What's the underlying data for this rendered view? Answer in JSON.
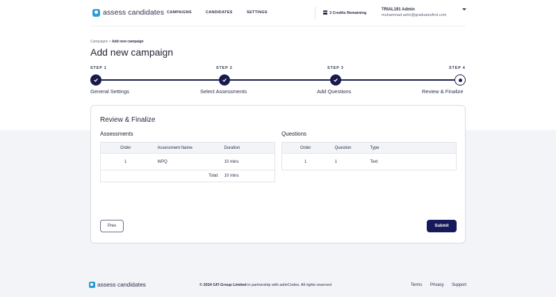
{
  "brand": {
    "logo_text": "assess candidates",
    "accent": "#171a4e",
    "logo_color": "#2a9bd6"
  },
  "header": {
    "nav": [
      "CAMPAIGNS",
      "CANDIDATES",
      "SETTINGS"
    ],
    "credits": "3 Credits Remaining",
    "user_name": "TRIAL191 Admin",
    "user_email": "muhammad.ashir@graduatesfirst.com"
  },
  "breadcrumb": {
    "parent": "Campaigns",
    "separator": ">",
    "current": "Add new campaign"
  },
  "page_title": "Add new campaign",
  "steps": [
    {
      "label": "STEP 1",
      "name": "General Settings",
      "status": "complete"
    },
    {
      "label": "STEP 2",
      "name": "Select Assessments",
      "status": "complete"
    },
    {
      "label": "STEP 3",
      "name": "Add Questions",
      "status": "complete"
    },
    {
      "label": "STEP 4",
      "name": "Review & Finalize",
      "status": "current"
    }
  ],
  "card": {
    "title": "Review & Finalize",
    "assessments": {
      "title": "Assessments",
      "headers": [
        "Order",
        "Assessment Name",
        "Duration"
      ],
      "rows": [
        {
          "order": "1",
          "name": "WPQ",
          "duration": "10 mins"
        }
      ],
      "total_label": "Total:",
      "total_value": "10 mins"
    },
    "questions": {
      "title": "Questions",
      "headers": [
        "Order",
        "Question",
        "Type"
      ],
      "rows": [
        {
          "order": "1",
          "question": "1",
          "type": "Text"
        }
      ]
    },
    "prev_label": "Prev",
    "submit_label": "Submit"
  },
  "footer": {
    "logo_text": "assess candidates",
    "copyright_bold": "© 2024 GFI Group Limited",
    "copyright_rest": " in partnership with ashirCodes. All rights reserved",
    "links": [
      "Terms",
      "Privacy",
      "Support"
    ]
  }
}
